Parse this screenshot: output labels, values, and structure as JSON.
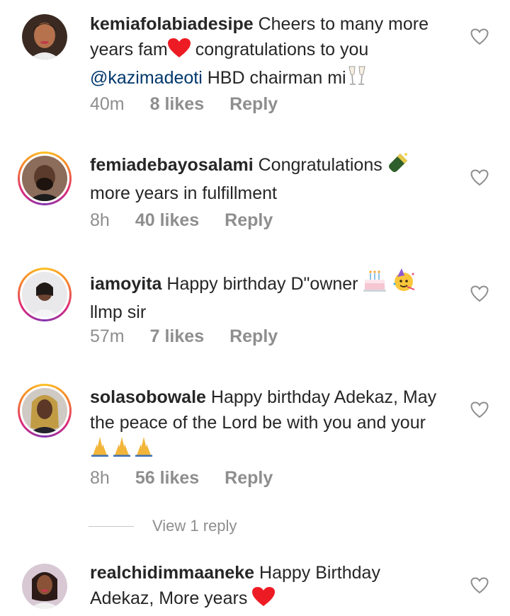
{
  "comments": [
    {
      "username": "kemiafolabiadesipe",
      "text_a": " Cheers to many more years fam",
      "text_b": " congratulations to you ",
      "mention": "@kazimadeoti",
      "text_c": " HBD chairman mi",
      "time": "40m",
      "likes": "8 likes",
      "reply": "Reply",
      "story_ring": false
    },
    {
      "username": "femiadebayosalami",
      "text_a": " Congratulations ",
      "text_b": " more years in fulfillment",
      "time": "8h",
      "likes": "40 likes",
      "reply": "Reply",
      "story_ring": true
    },
    {
      "username": "iamoyita",
      "text_a": " Happy birthday D\"owner ",
      "text_b": " llmp sir",
      "time": "57m",
      "likes": "7 likes",
      "reply": "Reply",
      "story_ring": true
    },
    {
      "username": "solasobowale",
      "text_a": " Happy  birthday  Adekaz, May the peace of the Lord be with you and your ",
      "time": "8h",
      "likes": "56 likes",
      "reply": "Reply",
      "story_ring": true,
      "view_replies": "View 1 reply"
    },
    {
      "username": "realchidimmaaneke",
      "text_a": " Happy Birthday Adekaz, More years ",
      "story_ring": false
    }
  ],
  "colors": {
    "text": "#262626",
    "secondary": "#8e8e8e",
    "mention": "#00376b",
    "heart_red": "#ed1c24"
  },
  "icons": [
    "heart-outline-icon",
    "red-heart-emoji",
    "champagne-glasses-emoji",
    "champagne-bottle-emoji",
    "birthday-cake-emoji",
    "partying-face-emoji",
    "folded-hands-emoji"
  ]
}
